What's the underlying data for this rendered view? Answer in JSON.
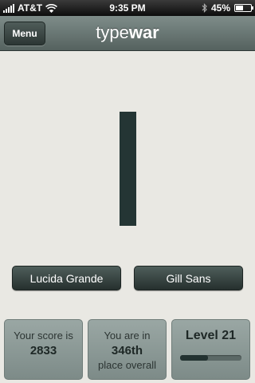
{
  "status_bar": {
    "carrier": "AT&T",
    "time": "9:35 PM",
    "battery": "45%",
    "icons": [
      "signal-icon",
      "wifi-icon",
      "bluetooth-icon",
      "battery-icon"
    ]
  },
  "nav": {
    "menu_label": "Menu",
    "title_part1": "type",
    "title_part2": "war"
  },
  "choices": {
    "left": "Lucida Grande",
    "right": "Gill Sans"
  },
  "stats": {
    "score_line1": "Your score is",
    "score_value": "2833",
    "place_line1": "You are in",
    "place_value": "346th",
    "place_line3": "place overall",
    "level": "Level 21",
    "level_progress": 0.45
  },
  "colors": {
    "background": "#e9e8e3",
    "accent_dark": "#243534",
    "nav_bar": "#6b7875"
  }
}
